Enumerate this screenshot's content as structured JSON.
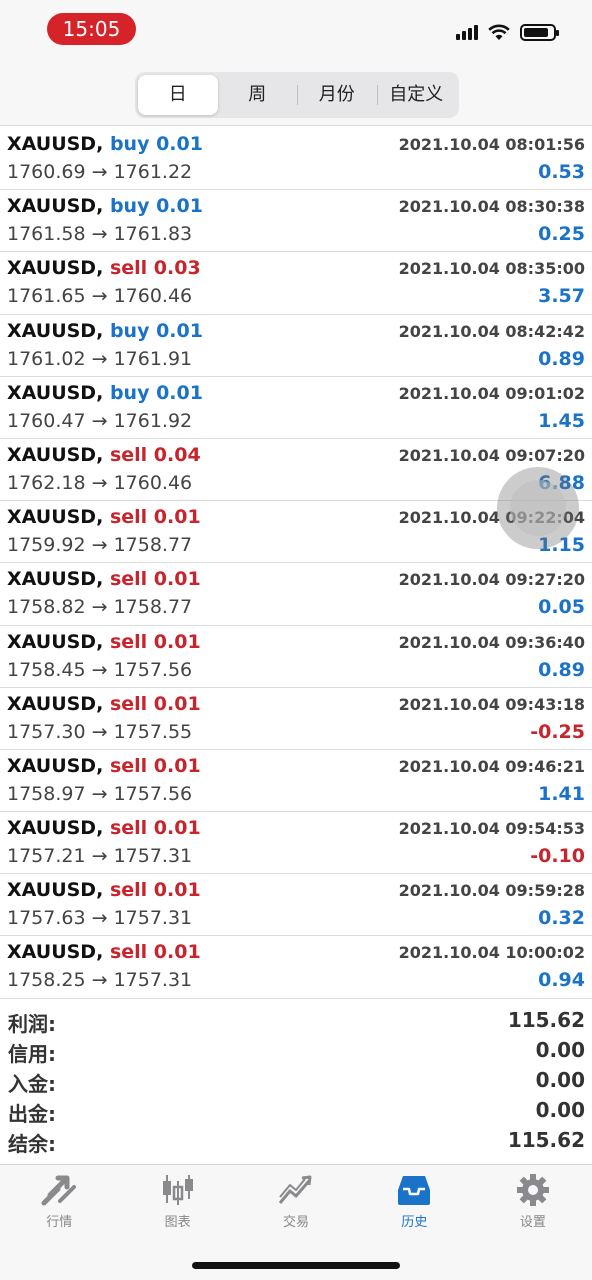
{
  "status": {
    "time": "15:05"
  },
  "period_tabs": [
    "日",
    "周",
    "月份",
    "自定义"
  ],
  "active_period": 0,
  "deals": [
    {
      "symbol": "XAUUSD,",
      "side": "buy",
      "lots": "0.01",
      "time": "2021.10.04 08:01:56",
      "prices": "1760.69 → 1761.22",
      "profit": "0.53"
    },
    {
      "symbol": "XAUUSD,",
      "side": "buy",
      "lots": "0.01",
      "time": "2021.10.04 08:30:38",
      "prices": "1761.58 → 1761.83",
      "profit": "0.25"
    },
    {
      "symbol": "XAUUSD,",
      "side": "sell",
      "lots": "0.03",
      "time": "2021.10.04 08:35:00",
      "prices": "1761.65 → 1760.46",
      "profit": "3.57"
    },
    {
      "symbol": "XAUUSD,",
      "side": "buy",
      "lots": "0.01",
      "time": "2021.10.04 08:42:42",
      "prices": "1761.02 → 1761.91",
      "profit": "0.89"
    },
    {
      "symbol": "XAUUSD,",
      "side": "buy",
      "lots": "0.01",
      "time": "2021.10.04 09:01:02",
      "prices": "1760.47 → 1761.92",
      "profit": "1.45"
    },
    {
      "symbol": "XAUUSD,",
      "side": "sell",
      "lots": "0.04",
      "time": "2021.10.04 09:07:20",
      "prices": "1762.18 → 1760.46",
      "profit": "6.88"
    },
    {
      "symbol": "XAUUSD,",
      "side": "sell",
      "lots": "0.01",
      "time": "2021.10.04 09:22:04",
      "prices": "1759.92 → 1758.77",
      "profit": "1.15"
    },
    {
      "symbol": "XAUUSD,",
      "side": "sell",
      "lots": "0.01",
      "time": "2021.10.04 09:27:20",
      "prices": "1758.82 → 1758.77",
      "profit": "0.05"
    },
    {
      "symbol": "XAUUSD,",
      "side": "sell",
      "lots": "0.01",
      "time": "2021.10.04 09:36:40",
      "prices": "1758.45 → 1757.56",
      "profit": "0.89"
    },
    {
      "symbol": "XAUUSD,",
      "side": "sell",
      "lots": "0.01",
      "time": "2021.10.04 09:43:18",
      "prices": "1757.30 → 1757.55",
      "profit": "-0.25"
    },
    {
      "symbol": "XAUUSD,",
      "side": "sell",
      "lots": "0.01",
      "time": "2021.10.04 09:46:21",
      "prices": "1758.97 → 1757.56",
      "profit": "1.41"
    },
    {
      "symbol": "XAUUSD,",
      "side": "sell",
      "lots": "0.01",
      "time": "2021.10.04 09:54:53",
      "prices": "1757.21 → 1757.31",
      "profit": "-0.10"
    },
    {
      "symbol": "XAUUSD,",
      "side": "sell",
      "lots": "0.01",
      "time": "2021.10.04 09:59:28",
      "prices": "1757.63 → 1757.31",
      "profit": "0.32"
    },
    {
      "symbol": "XAUUSD,",
      "side": "sell",
      "lots": "0.01",
      "time": "2021.10.04 10:00:02",
      "prices": "1758.25 → 1757.31",
      "profit": "0.94"
    }
  ],
  "summary": [
    {
      "label": "利润:",
      "value": "115.62"
    },
    {
      "label": "信用:",
      "value": "0.00"
    },
    {
      "label": "入金:",
      "value": "0.00"
    },
    {
      "label": "出金:",
      "value": "0.00"
    },
    {
      "label": "结余:",
      "value": "115.62"
    }
  ],
  "tabbar": [
    {
      "label": "行情",
      "icon": "quotes-arrows-icon"
    },
    {
      "label": "图表",
      "icon": "candlestick-chart-icon"
    },
    {
      "label": "交易",
      "icon": "trade-trend-icon"
    },
    {
      "label": "历史",
      "icon": "history-tray-icon"
    },
    {
      "label": "设置",
      "icon": "settings-gear-icon"
    }
  ],
  "active_tab": 3,
  "colors": {
    "buy": "#1a73c9",
    "sell": "#c8242b",
    "accent": "#1a73c9",
    "time_pill": "#d6232a"
  }
}
